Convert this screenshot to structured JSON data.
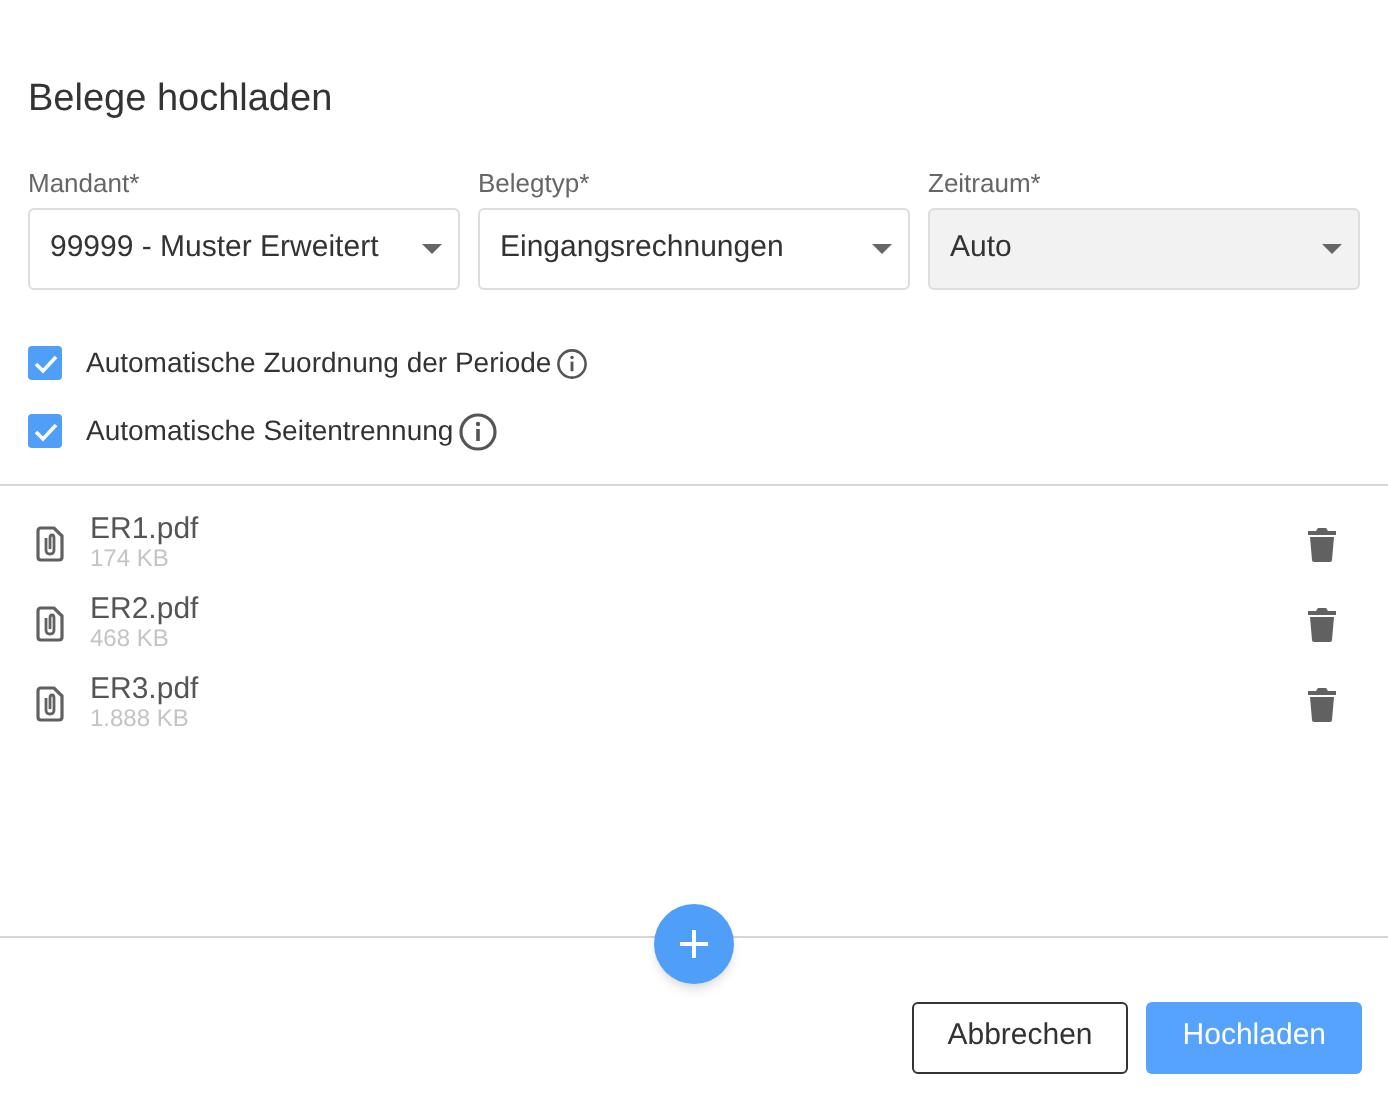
{
  "dialog": {
    "title": "Belege hochladen"
  },
  "fields": [
    {
      "label": "Mandant*",
      "value": "99999 - Muster Erweitert",
      "disabled": false
    },
    {
      "label": "Belegtyp*",
      "value": "Eingangsrechnungen",
      "disabled": false
    },
    {
      "label": "Zeitraum*",
      "value": "Auto",
      "disabled": true
    }
  ],
  "options": [
    {
      "label": "Automatische Zuordnung der Periode",
      "checked": true
    },
    {
      "label": "Automatische Seitentrennung",
      "checked": true
    }
  ],
  "files": [
    {
      "name": "ER1.pdf",
      "size": "174 KB"
    },
    {
      "name": "ER2.pdf",
      "size": "468 KB"
    },
    {
      "name": "ER3.pdf",
      "size": "1.888 KB"
    }
  ],
  "buttons": {
    "cancel": "Abbrechen",
    "upload": "Hochladen"
  }
}
